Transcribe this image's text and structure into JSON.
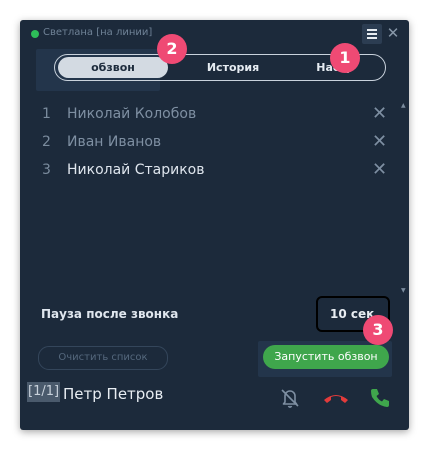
{
  "header": {
    "status_color": "#2ebd59",
    "user_status": "Светлана [на линии]",
    "menu_icon": "hamburger-menu-icon",
    "close_label": "✕"
  },
  "tabs": [
    {
      "label": "обзвон",
      "active": true
    },
    {
      "label": "История",
      "active": false
    },
    {
      "label": "Настр",
      "active": false
    }
  ],
  "call_list": [
    {
      "num": "1",
      "name": "Николай Колобов"
    },
    {
      "num": "2",
      "name": "Иван Иванов"
    },
    {
      "num": "3",
      "name": "Николай Стариков"
    }
  ],
  "remove_label": "✕",
  "pause": {
    "label": "Пауза после звонка",
    "value": "10 сек"
  },
  "buttons": {
    "clear": "Очистить список",
    "start": "Запустить обзвон"
  },
  "current_call": {
    "counter": "[1/1]",
    "name": "Петр Петров",
    "mute_icon": "bell-off-icon",
    "hangup_icon": "hangup-phone-icon",
    "answer_icon": "phone-icon"
  },
  "callouts": {
    "menu": "1",
    "tab": "2",
    "start": "3"
  },
  "colors": {
    "accent_green": "#3fa64c",
    "hangup_red": "#e23b3b",
    "callout_pink": "#ef4a74",
    "panel_bg": "#1c2a3b"
  }
}
